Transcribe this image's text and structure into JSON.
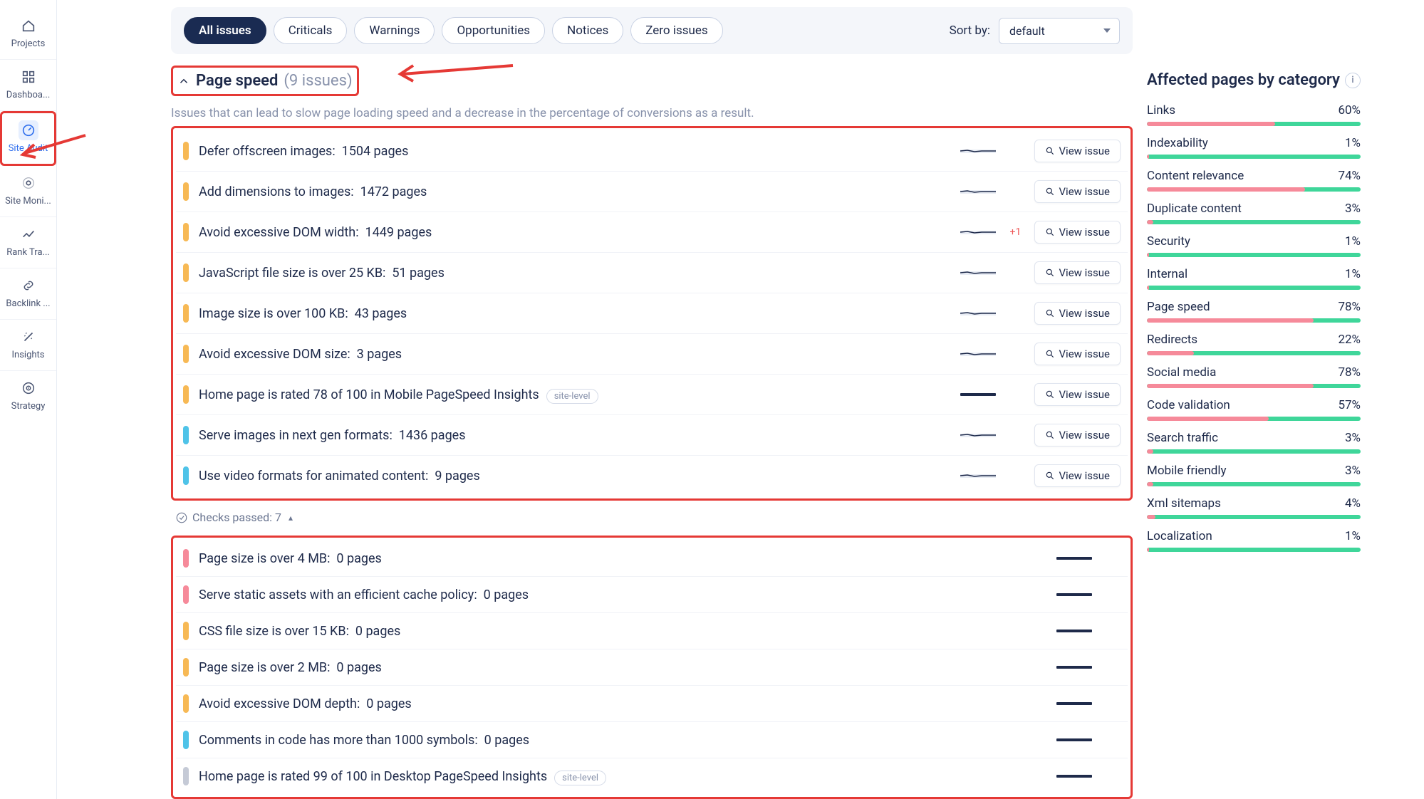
{
  "sidebar": {
    "items": [
      {
        "label": "Projects",
        "icon": "home"
      },
      {
        "label": "Dashboa...",
        "icon": "grid"
      },
      {
        "label": "Site Audit",
        "icon": "gauge",
        "active": true,
        "annot": true
      },
      {
        "label": "Site Moni...",
        "icon": "pulse"
      },
      {
        "label": "Rank Tra...",
        "icon": "trend"
      },
      {
        "label": "Backlink ...",
        "icon": "link"
      },
      {
        "label": "Insights",
        "icon": "wand"
      },
      {
        "label": "Strategy",
        "icon": "target"
      }
    ]
  },
  "filters": {
    "pills": [
      "All issues",
      "Criticals",
      "Warnings",
      "Opportunities",
      "Notices",
      "Zero issues"
    ],
    "active": 0,
    "sort_label": "Sort by:",
    "sort_value": "default"
  },
  "section": {
    "title": "Page speed",
    "count_text": "(9 issues)",
    "desc": "Issues that can lead to slow page loading speed and a decrease in the percentage of conversions as a result."
  },
  "view_issue_label": "View issue",
  "issues": [
    {
      "sev": "orange",
      "title": "Defer offscreen images:",
      "pages": "1504 pages",
      "view": true,
      "spark": true
    },
    {
      "sev": "orange",
      "title": "Add dimensions to images:",
      "pages": "1472 pages",
      "view": true,
      "spark": true
    },
    {
      "sev": "orange",
      "title": "Avoid excessive DOM width:",
      "pages": "1449 pages",
      "view": true,
      "spark": true,
      "delta": "+1"
    },
    {
      "sev": "orange",
      "title": "JavaScript file size is over 25 KB:",
      "pages": "51 pages",
      "view": true,
      "spark": true
    },
    {
      "sev": "orange",
      "title": "Image size is over 100 KB:",
      "pages": "43 pages",
      "view": true,
      "spark": true
    },
    {
      "sev": "orange",
      "title": "Avoid excessive DOM size:",
      "pages": "3 pages",
      "view": true,
      "spark": true
    },
    {
      "sev": "orange",
      "title": "Home page is rated 78 of 100 in Mobile PageSpeed Insights",
      "pages": "",
      "view": true,
      "badge": "site-level"
    },
    {
      "sev": "blue",
      "title": "Serve images in next gen formats:",
      "pages": "1436 pages",
      "view": true,
      "spark": true
    },
    {
      "sev": "blue",
      "title": "Use video formats for animated content:",
      "pages": "9 pages",
      "view": true,
      "spark": true
    }
  ],
  "checks_passed_label": "Checks passed: 7",
  "passed": [
    {
      "sev": "red",
      "title": "Page size is over 4 MB:",
      "pages": "0 pages"
    },
    {
      "sev": "red",
      "title": "Serve static assets with an efficient cache policy:",
      "pages": "0 pages"
    },
    {
      "sev": "orange",
      "title": "CSS file size is over 15 KB:",
      "pages": "0 pages"
    },
    {
      "sev": "orange",
      "title": "Page size is over 2 MB:",
      "pages": "0 pages"
    },
    {
      "sev": "orange",
      "title": "Avoid excessive DOM depth:",
      "pages": "0 pages"
    },
    {
      "sev": "blue",
      "title": "Comments in code has more than 1000 symbols:",
      "pages": "0 pages"
    },
    {
      "sev": "grey",
      "title": "Home page is rated 99 of 100 in Desktop PageSpeed Insights",
      "pages": "",
      "badge": "site-level"
    }
  ],
  "right": {
    "title": "Affected pages by category",
    "categories": [
      {
        "name": "Links",
        "pct": "60%",
        "val": 60
      },
      {
        "name": "Indexability",
        "pct": "1%",
        "val": 1
      },
      {
        "name": "Content relevance",
        "pct": "74%",
        "val": 74
      },
      {
        "name": "Duplicate content",
        "pct": "3%",
        "val": 3
      },
      {
        "name": "Security",
        "pct": "1%",
        "val": 1
      },
      {
        "name": "Internal",
        "pct": "1%",
        "val": 1
      },
      {
        "name": "Page speed",
        "pct": "78%",
        "val": 78
      },
      {
        "name": "Redirects",
        "pct": "22%",
        "val": 22
      },
      {
        "name": "Social media",
        "pct": "78%",
        "val": 78
      },
      {
        "name": "Code validation",
        "pct": "57%",
        "val": 57
      },
      {
        "name": "Search traffic",
        "pct": "3%",
        "val": 3
      },
      {
        "name": "Mobile friendly",
        "pct": "3%",
        "val": 3
      },
      {
        "name": "Xml sitemaps",
        "pct": "4%",
        "val": 4
      },
      {
        "name": "Localization",
        "pct": "1%",
        "val": 1
      }
    ]
  }
}
